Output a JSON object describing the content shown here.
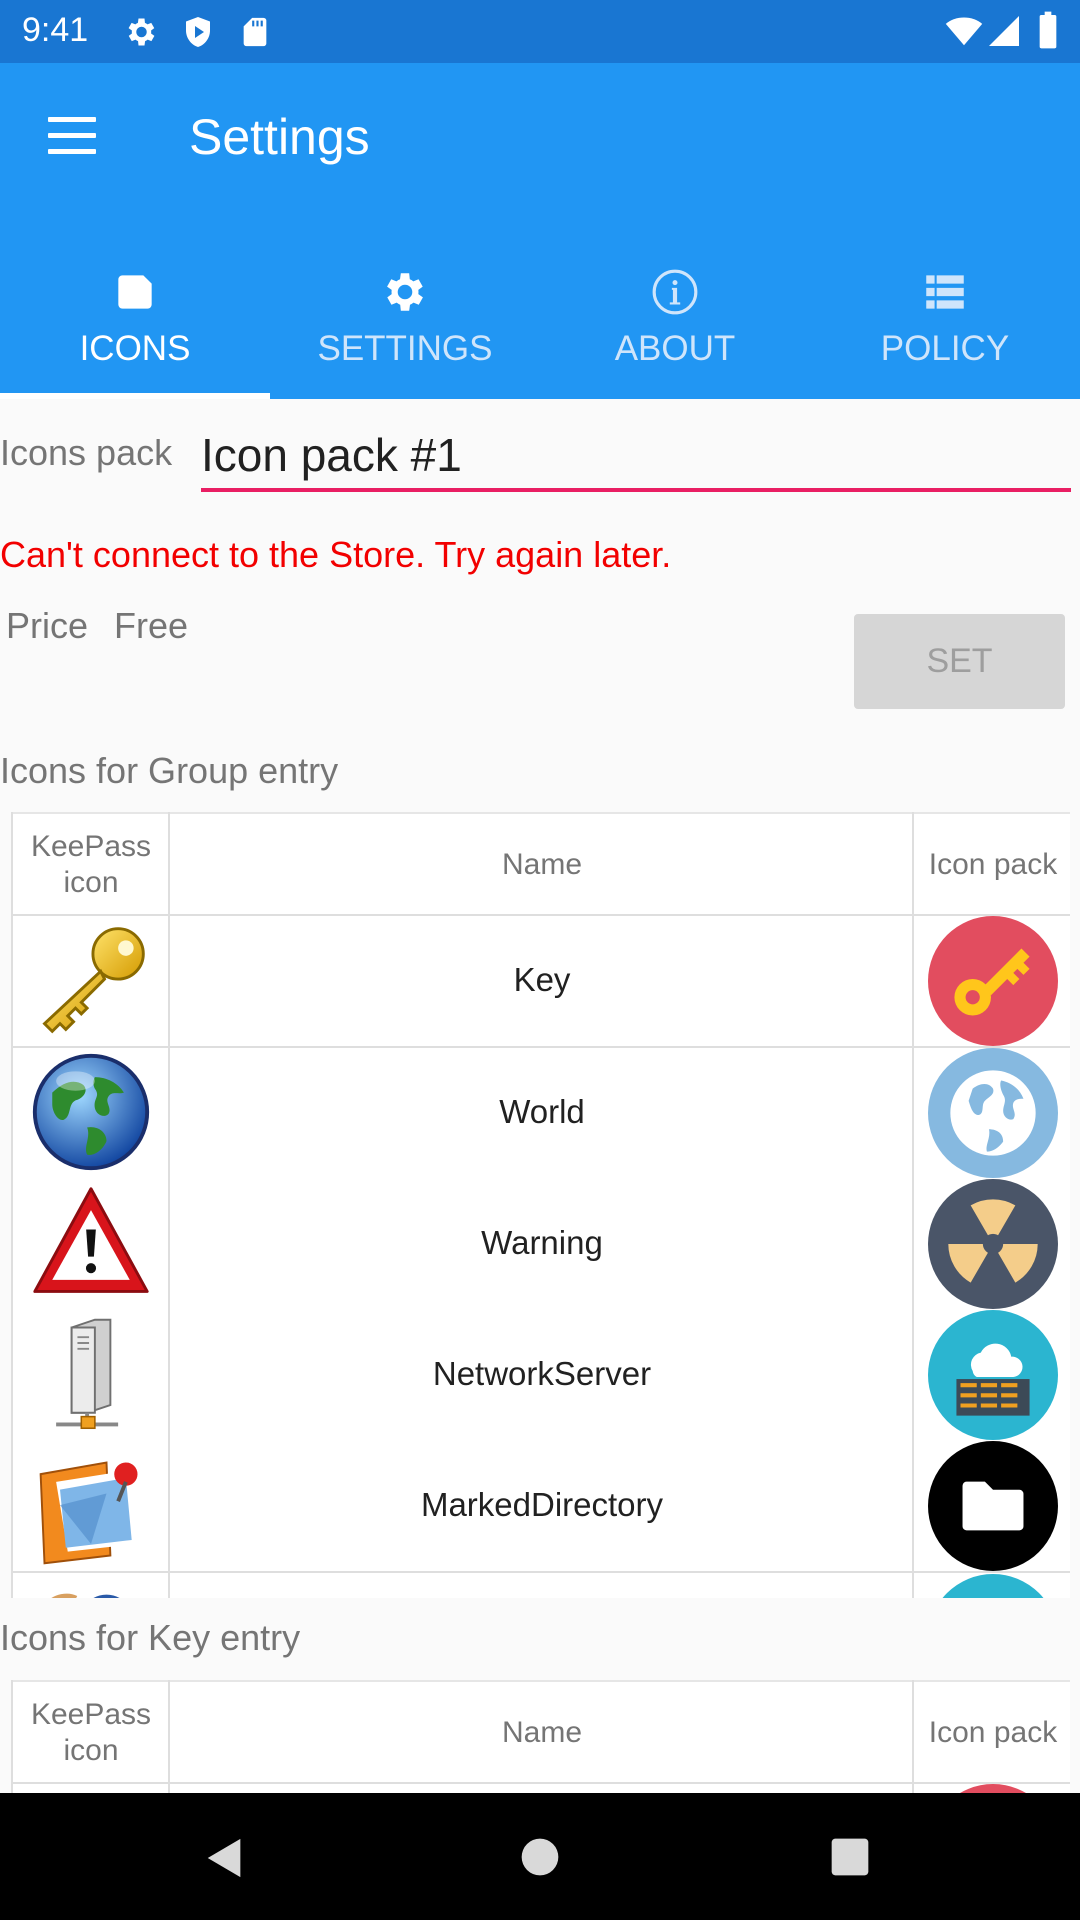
{
  "status_bar": {
    "time": "9:41"
  },
  "app_bar": {
    "title": "Settings"
  },
  "tabs": [
    {
      "label": "ICONS",
      "icon": "sd-card-icon",
      "active": true
    },
    {
      "label": "SETTINGS",
      "icon": "gear-icon",
      "active": false
    },
    {
      "label": "ABOUT",
      "icon": "info-icon",
      "active": false
    },
    {
      "label": "POLICY",
      "icon": "list-icon",
      "active": false
    }
  ],
  "icons_pack": {
    "label": "Icons pack",
    "value": "Icon pack #1"
  },
  "error": "Can't connect to the Store. Try again later.",
  "price": {
    "label": "Price",
    "value": "Free"
  },
  "set_button": "SET",
  "group_section": {
    "title": "Icons for Group entry",
    "headers": {
      "keepass": "KeePass icon",
      "name": "Name",
      "pack": "Icon pack"
    },
    "rows": [
      {
        "name": "Key",
        "kp_icon": "key-icon",
        "pack_icon": "key-circle-icon"
      },
      {
        "name": "World",
        "kp_icon": "globe-icon",
        "pack_icon": "globe-circle-icon"
      },
      {
        "name": "Warning",
        "kp_icon": "warning-icon",
        "pack_icon": "radiation-circle-icon"
      },
      {
        "name": "NetworkServer",
        "kp_icon": "server-icon",
        "pack_icon": "cloud-server-circle-icon"
      },
      {
        "name": "MarkedDirectory",
        "kp_icon": "marked-directory-icon",
        "pack_icon": "folder-circle-icon"
      }
    ]
  },
  "key_section": {
    "title": "Icons for Key entry",
    "headers": {
      "keepass": "KeePass icon",
      "name": "Name",
      "pack": "Icon pack"
    }
  },
  "colors": {
    "status_bar": "#1976d2",
    "app_bar": "#2196f3",
    "accent_underline": "#e91e63",
    "error": "#f20000"
  }
}
